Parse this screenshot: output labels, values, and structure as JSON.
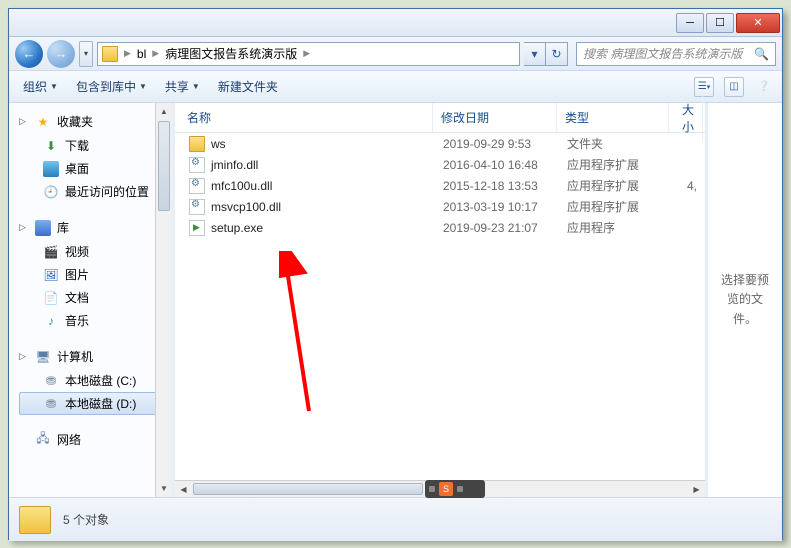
{
  "breadcrumb": {
    "seg1": "bl",
    "seg2": "病理图文报告系统演示版"
  },
  "search": {
    "placeholder": "搜索 病理图文报告系统演示版"
  },
  "toolbar": {
    "organize": "组织",
    "include": "包含到库中",
    "share": "共享",
    "newfolder": "新建文件夹"
  },
  "sidebar": {
    "favorites": {
      "label": "收藏夹",
      "items": [
        {
          "label": "下载"
        },
        {
          "label": "桌面"
        },
        {
          "label": "最近访问的位置"
        }
      ]
    },
    "libraries": {
      "label": "库",
      "items": [
        {
          "label": "视频"
        },
        {
          "label": "图片"
        },
        {
          "label": "文档"
        },
        {
          "label": "音乐"
        }
      ]
    },
    "computer": {
      "label": "计算机",
      "items": [
        {
          "label": "本地磁盘 (C:)"
        },
        {
          "label": "本地磁盘 (D:)"
        }
      ]
    },
    "network": {
      "label": "网络"
    }
  },
  "columns": {
    "name": "名称",
    "date": "修改日期",
    "type": "类型",
    "size": "大小"
  },
  "files": [
    {
      "icon": "folder",
      "name": "ws",
      "date": "2019-09-29 9:53",
      "type": "文件夹",
      "size": ""
    },
    {
      "icon": "dll",
      "name": "jminfo.dll",
      "date": "2016-04-10 16:48",
      "type": "应用程序扩展",
      "size": ""
    },
    {
      "icon": "dll",
      "name": "mfc100u.dll",
      "date": "2015-12-18 13:53",
      "type": "应用程序扩展",
      "size": "4,"
    },
    {
      "icon": "dll",
      "name": "msvcp100.dll",
      "date": "2013-03-19 10:17",
      "type": "应用程序扩展",
      "size": ""
    },
    {
      "icon": "exe",
      "name": "setup.exe",
      "date": "2019-09-23 21:07",
      "type": "应用程序",
      "size": ""
    }
  ],
  "preview": {
    "text": "选择要预览的文件。"
  },
  "status": {
    "text": "5 个对象"
  },
  "annotation_arrow": {
    "color": "#ff0000"
  }
}
